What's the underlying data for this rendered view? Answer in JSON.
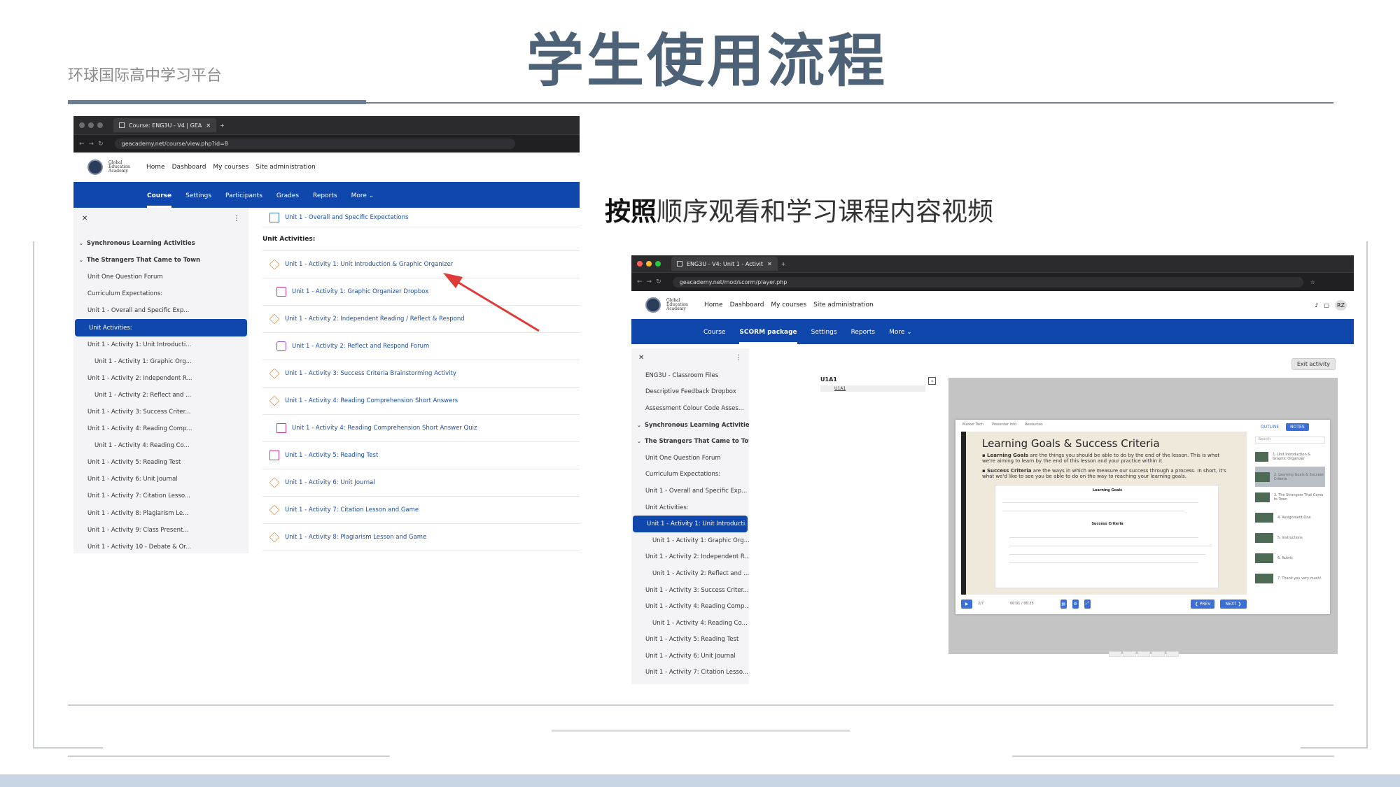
{
  "slide": {
    "title": "学生使用流程",
    "subtitle": "环球国际高中学习平台",
    "instruction_bold": "按照",
    "instruction_rest": "顺序观看和学习课程内容视频"
  },
  "shot1": {
    "browser_tab": "Course: ENG3U - V4 | GEA",
    "url": "geacademy.net/course/view.php?id=8",
    "logo_text": "Global Education Academy",
    "topnav": [
      "Home",
      "Dashboard",
      "My courses",
      "Site administration"
    ],
    "course_tabs": [
      "Course",
      "Settings",
      "Participants",
      "Grades",
      "Reports",
      "More ⌄"
    ],
    "sidebar_close": "✕",
    "sidebar_menu": "⋮",
    "sidebar": [
      {
        "label": "Synchronous Learning Activities",
        "kind": "sec"
      },
      {
        "label": "The Strangers That Came to Town",
        "kind": "sec"
      },
      {
        "label": "Unit One Question Forum",
        "kind": "item"
      },
      {
        "label": "Curriculum Expectations:",
        "kind": "item"
      },
      {
        "label": "Unit 1 - Overall and Specific Exp...",
        "kind": "item"
      },
      {
        "label": "Unit Activities:",
        "kind": "sel"
      },
      {
        "label": "Unit 1 - Activity 1: Unit Introducti...",
        "kind": "item"
      },
      {
        "label": "Unit 1 - Activity 1: Graphic Org...",
        "kind": "sub"
      },
      {
        "label": "Unit 1 - Activity 2: Independent R...",
        "kind": "item"
      },
      {
        "label": "Unit 1 - Activity 2: Reflect and ...",
        "kind": "sub"
      },
      {
        "label": "Unit 1 - Activity 3: Success Criter...",
        "kind": "item"
      },
      {
        "label": "Unit 1 - Activity 4: Reading Comp...",
        "kind": "item"
      },
      {
        "label": "Unit 1 - Activity 4: Reading Co...",
        "kind": "sub"
      },
      {
        "label": "Unit 1 - Activity 5: Reading Test",
        "kind": "item"
      },
      {
        "label": "Unit 1 - Activity 6: Unit Journal",
        "kind": "item"
      },
      {
        "label": "Unit 1 - Activity 7: Citation Lesso...",
        "kind": "item"
      },
      {
        "label": "Unit 1 - Activity 8: Plagiarism Le...",
        "kind": "item"
      },
      {
        "label": "Unit 1 - Activity 9: Class Present...",
        "kind": "item"
      },
      {
        "label": "Unit 1 - Activity 10 - Debate & Or...",
        "kind": "item"
      }
    ],
    "top_link": "Unit 1 - Overall and Specific Expectations",
    "activities_heading": "Unit Activities:",
    "activities": [
      {
        "label": "Unit 1 - Activity 1: Unit Introduction & Graphic Organizer",
        "icon": "box",
        "indent": false
      },
      {
        "label": "Unit 1 - Activity 1: Graphic Organizer Dropbox",
        "icon": "drop",
        "indent": true
      },
      {
        "label": "Unit 1 - Activity 2: Independent Reading / Reflect & Respond",
        "icon": "box",
        "indent": false
      },
      {
        "label": "Unit 1 - Activity 2: Reflect and Respond Forum",
        "icon": "forum",
        "indent": true
      },
      {
        "label": "Unit 1 - Activity 3: Success Criteria Brainstorming Activity",
        "icon": "box",
        "indent": false
      },
      {
        "label": "Unit 1 - Activity 4: Reading Comprehension Short Answers",
        "icon": "box",
        "indent": false
      },
      {
        "label": "Unit 1 - Activity 4: Reading Comprehension Short Answer Quiz",
        "icon": "quiz",
        "indent": true
      },
      {
        "label": "Unit 1 - Activity 5: Reading Test",
        "icon": "quiz",
        "indent": false
      },
      {
        "label": "Unit 1 - Activity 6: Unit Journal",
        "icon": "box",
        "indent": false
      },
      {
        "label": "Unit 1 - Activity 7: Citation Lesson and Game",
        "icon": "box",
        "indent": false
      },
      {
        "label": "Unit 1 - Activity 8: Plagiarism Lesson and Game",
        "icon": "box",
        "indent": false
      }
    ]
  },
  "shot2": {
    "browser_tab": "ENG3U - V4: Unit 1 - Activit",
    "url": "geacademy.net/mod/scorm/player.php",
    "logo_text": "Global Education Academy",
    "topnav": [
      "Home",
      "Dashboard",
      "My courses",
      "Site administration"
    ],
    "user_initials": "RZ",
    "course_tabs": [
      "Course",
      "SCORM package",
      "Settings",
      "Reports",
      "More ⌄"
    ],
    "exit_button": "Exit activity",
    "sidebar_close": "✕",
    "sidebar_menu": "⋮",
    "sidebar": [
      {
        "label": "ENG3U - Classroom Files",
        "kind": "item"
      },
      {
        "label": "Descriptive Feedback Dropbox",
        "kind": "item"
      },
      {
        "label": "Assessment Colour Code Asses...",
        "kind": "item"
      },
      {
        "label": "Synchronous Learning Activities",
        "kind": "sec"
      },
      {
        "label": "The Strangers That Came to Town",
        "kind": "sec"
      },
      {
        "label": "Unit One Question Forum",
        "kind": "item"
      },
      {
        "label": "Curriculum Expectations:",
        "kind": "item"
      },
      {
        "label": "Unit 1 - Overall and Specific Exp...",
        "kind": "item"
      },
      {
        "label": "Unit Activities:",
        "kind": "item"
      },
      {
        "label": "Unit 1 - Activity 1: Unit Introducti...",
        "kind": "sel"
      },
      {
        "label": "Unit 1 - Activity 1: Graphic Org...",
        "kind": "sub"
      },
      {
        "label": "Unit 1 - Activity 2: Independent R...",
        "kind": "item"
      },
      {
        "label": "Unit 1 - Activity 2: Reflect and ...",
        "kind": "sub"
      },
      {
        "label": "Unit 1 - Activity 3: Success Criter...",
        "kind": "item"
      },
      {
        "label": "Unit 1 - Activity 4: Reading Comp...",
        "kind": "item"
      },
      {
        "label": "Unit 1 - Activity 4: Reading Co...",
        "kind": "sub"
      },
      {
        "label": "Unit 1 - Activity 5: Reading Test",
        "kind": "item"
      },
      {
        "label": "Unit 1 - Activity 6: Unit Journal",
        "kind": "item"
      },
      {
        "label": "Unit 1 - Activity 7: Citation Lesso...",
        "kind": "item"
      }
    ],
    "toc_title": "U1A1",
    "toc_item": "U1A1",
    "player": {
      "tabs": [
        "Marker Tech",
        "Presenter Info",
        "Resources"
      ],
      "outline_tab": "OUTLINE",
      "notes_tab": "NOTES",
      "search_placeholder": "Search",
      "slide_title": "Learning Goals & Success Criteria",
      "bullet1_bold": "Learning Goals",
      "bullet1": " are the things you should be able to do by the end of the lesson. This is what we're aiming to learn by the end of this lesson and your practice within it.",
      "bullet2_bold": "Success Criteria",
      "bullet2": " are the ways in which we measure our success through a process. In short, it's what we'd like to see you be able to do on the way to reaching your learning goals.",
      "doc_heading1": "Learning Goals",
      "doc_heading2": "Success Criteria",
      "outline_items": [
        "1. Unit Introduction & Graphic Organizer",
        "2. Learning Goals & Success Criteria",
        "3. The Strangers That Came to Town",
        "4. Assignment One",
        "5. Instructions",
        "6. Rubric",
        "7. Thank you very much!"
      ],
      "slide_counter": "2/7",
      "time": "00:01 / 00:23",
      "prev": "❮ PREV",
      "next": "NEXT ❯"
    }
  }
}
